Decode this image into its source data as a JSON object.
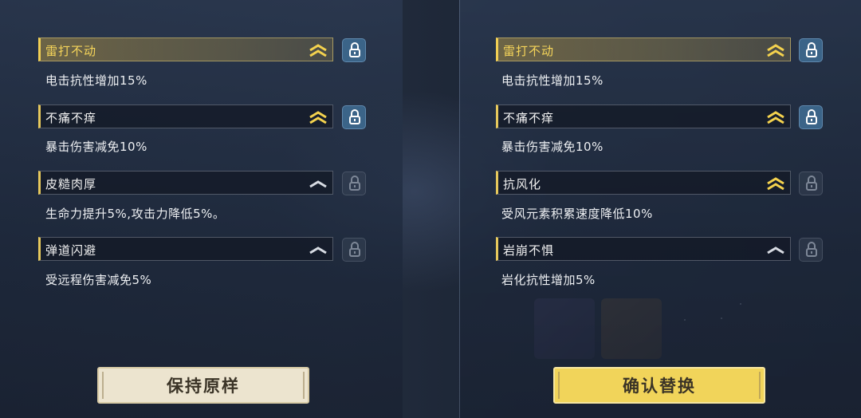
{
  "left_panel": {
    "traits": [
      {
        "name": "雷打不动",
        "desc": "电击抗性增加15%",
        "rank": "high",
        "locked": true
      },
      {
        "name": "不痛不痒",
        "desc": "暴击伤害减免10%",
        "rank": "high",
        "locked": true
      },
      {
        "name": "皮糙肉厚",
        "desc": "生命力提升5%,攻击力降低5%。",
        "rank": "low",
        "locked": false
      },
      {
        "name": "弹道闪避",
        "desc": "受远程伤害减免5%",
        "rank": "low",
        "locked": false
      }
    ],
    "button_label": "保持原样"
  },
  "right_panel": {
    "traits": [
      {
        "name": "雷打不动",
        "desc": "电击抗性增加15%",
        "rank": "high",
        "locked": true
      },
      {
        "name": "不痛不痒",
        "desc": "暴击伤害减免10%",
        "rank": "high",
        "locked": true
      },
      {
        "name": "抗风化",
        "desc": "受风元素积累速度降低10%",
        "rank": "high",
        "locked": false
      },
      {
        "name": "岩崩不惧",
        "desc": "岩化抗性增加5%",
        "rank": "low",
        "locked": false
      }
    ],
    "button_label": "确认替换"
  },
  "colors": {
    "gold": "#f1cf54",
    "lock_active": "#3b6488",
    "confirm_button": "#f1d45a",
    "keep_button": "#ece4cf"
  },
  "icons": {
    "rank_high": "double-chevron-up-icon",
    "rank_low": "single-chevron-up-icon",
    "lock": "padlock-icon"
  }
}
